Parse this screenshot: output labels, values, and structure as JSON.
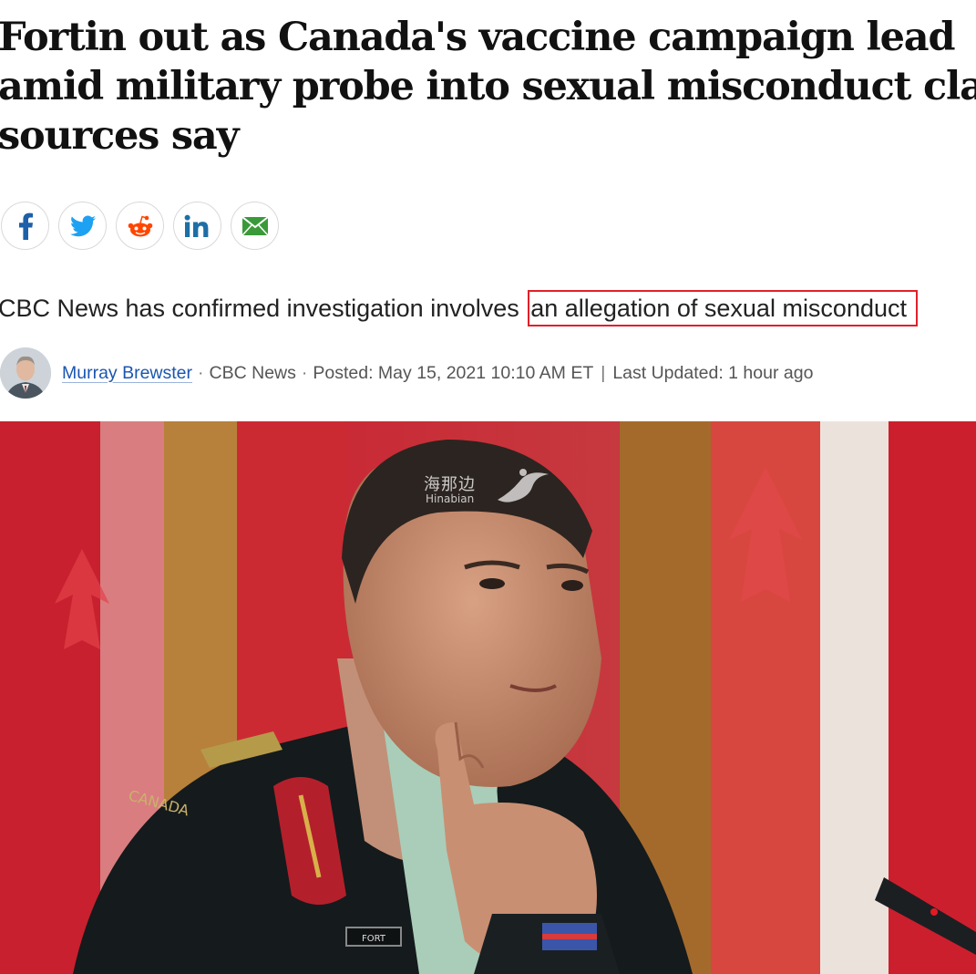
{
  "article": {
    "headline_lines": [
      "Fortin out as Canada's vaccine campaign lead",
      "amid military probe into sexual misconduct claim,",
      "sources say"
    ],
    "deck_lead": "CBC News has confirmed investigation involves ",
    "deck_highlight": "an allegation of sexual misconduct"
  },
  "share": {
    "buttons": [
      {
        "name": "facebook",
        "icon": "facebook-icon",
        "color": "#1d5fa8"
      },
      {
        "name": "twitter",
        "icon": "twitter-icon",
        "color": "#1da1f2"
      },
      {
        "name": "reddit",
        "icon": "reddit-icon",
        "color": "#ff4500"
      },
      {
        "name": "linkedin",
        "icon": "linkedin-icon",
        "color": "#1d6fa5"
      },
      {
        "name": "email",
        "icon": "email-icon",
        "color": "#3a9a3a"
      }
    ]
  },
  "byline": {
    "author": "Murray Brewster",
    "outlet": "CBC News",
    "posted": "Posted: May 15, 2021 10:10 AM ET",
    "updated": "Last Updated: 1 hour ago"
  },
  "hero": {
    "watermark_cn": "海那边",
    "watermark_en": "Hinabian",
    "uniform_label": "CANADA",
    "nametag": "FORT"
  },
  "colors": {
    "highlight_border": "#e0202a",
    "link": "#1a56b0",
    "flag_red": "#c8102e"
  }
}
